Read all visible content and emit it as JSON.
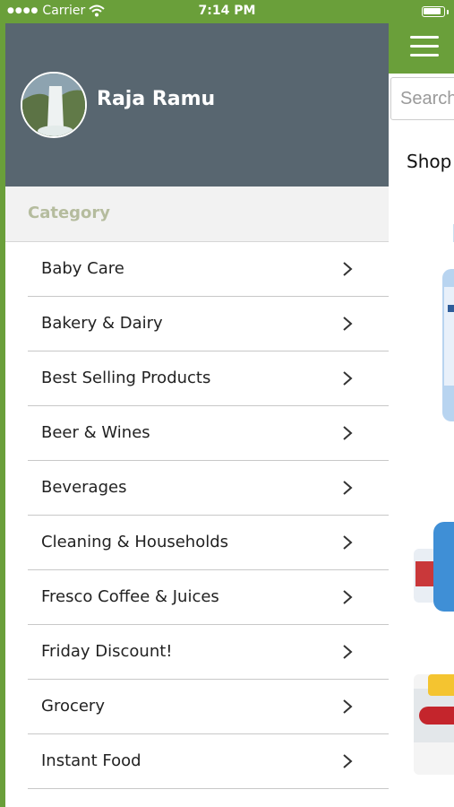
{
  "status_bar": {
    "carrier": "Carrier",
    "time": "7:14 PM"
  },
  "drawer": {
    "user_name": "Raja Ramu",
    "category_title": "Category",
    "categories": [
      {
        "label": "Baby Care"
      },
      {
        "label": "Bakery & Dairy"
      },
      {
        "label": "Best Selling Products"
      },
      {
        "label": "Beer & Wines"
      },
      {
        "label": "Beverages"
      },
      {
        "label": "Cleaning & Households"
      },
      {
        "label": "Fresco Coffee & Juices"
      },
      {
        "label": "Friday Discount!"
      },
      {
        "label": "Grocery"
      },
      {
        "label": "Instant Food"
      }
    ]
  },
  "background": {
    "search_placeholder": "Search",
    "shop_text": "Shop I"
  },
  "icons": {
    "menu": "hamburger-menu-icon",
    "chevron": "chevron-right-icon",
    "wifi": "wifi-icon",
    "battery": "battery-icon"
  },
  "colors": {
    "brand_green": "#6a9f3a",
    "drawer_header": "#586670",
    "category_text": "#b5bc9e"
  }
}
